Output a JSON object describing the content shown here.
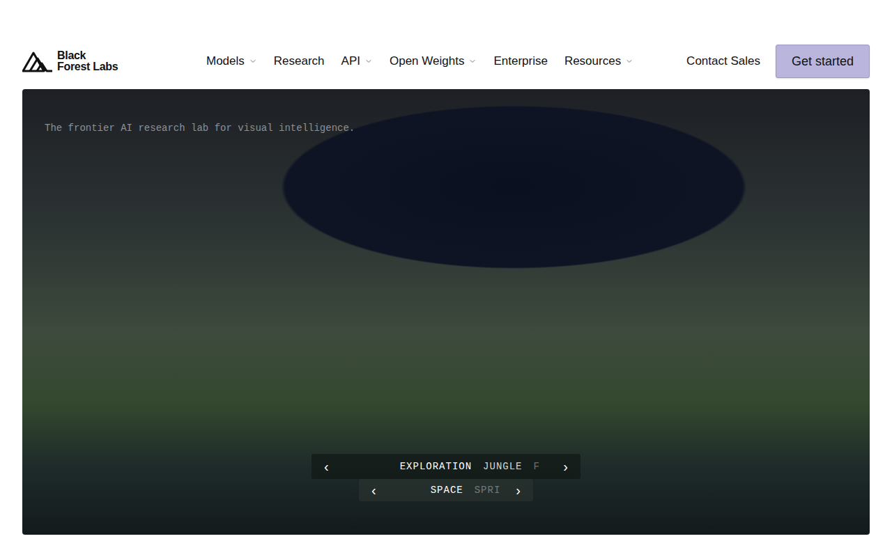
{
  "logo": {
    "lines": [
      "Black",
      "Forest Labs"
    ]
  },
  "nav": {
    "items": [
      {
        "label": "Models",
        "dropdown": true
      },
      {
        "label": "Research",
        "dropdown": false
      },
      {
        "label": "API",
        "dropdown": true
      },
      {
        "label": "Open Weights",
        "dropdown": true
      },
      {
        "label": "Enterprise",
        "dropdown": false
      },
      {
        "label": "Resources",
        "dropdown": true
      }
    ],
    "contact": "Contact Sales",
    "cta": "Get started"
  },
  "hero": {
    "tagline": "The frontier AI research lab for visual intelligence.",
    "carousels": [
      {
        "prev": "‹",
        "next": "›",
        "items": [
          {
            "label": "EXPLORATION",
            "selected": true,
            "faded": false
          },
          {
            "label": "JUNGLE",
            "selected": false,
            "faded": false
          },
          {
            "label": "F",
            "selected": false,
            "faded": true
          }
        ]
      },
      {
        "prev": "‹",
        "next": "›",
        "items": [
          {
            "label": "SPACE",
            "selected": true,
            "faded": false
          },
          {
            "label": "SPRI",
            "selected": false,
            "faded": true
          }
        ]
      }
    ]
  }
}
